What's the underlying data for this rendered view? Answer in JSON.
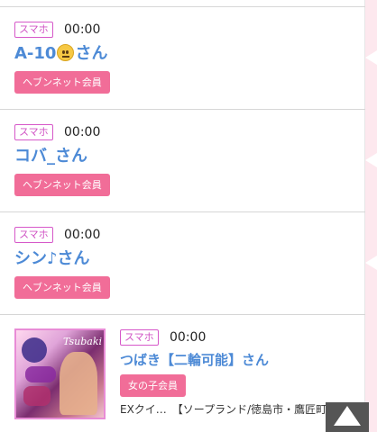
{
  "entries": [
    {
      "device": "スマホ",
      "time": "00:00",
      "name_pre": "A-10",
      "name_post": "さん",
      "emoji": "neutral-face-emoji",
      "member_label": "ヘブンネット会員"
    },
    {
      "device": "スマホ",
      "time": "00:00",
      "name": "コバ_さん",
      "member_label": "ヘブンネット会員"
    },
    {
      "device": "スマホ",
      "time": "00:00",
      "name": "シン♪さん",
      "member_label": "ヘブンネット会員"
    },
    {
      "device": "スマホ",
      "time": "00:00",
      "name": "つばき【二輪可能】さん",
      "member_label": "女の子会員",
      "thumb_script": "Tsubaki",
      "description": "EXクイ…　【ソープランド/徳島市・鷹匠町…"
    }
  ],
  "colors": {
    "name": "#4d8ad6",
    "badge_border": "#d658c9",
    "member_button": "#f16d98",
    "strip": "#fde8ee"
  },
  "scroll_top_icon": "up-arrow-icon"
}
